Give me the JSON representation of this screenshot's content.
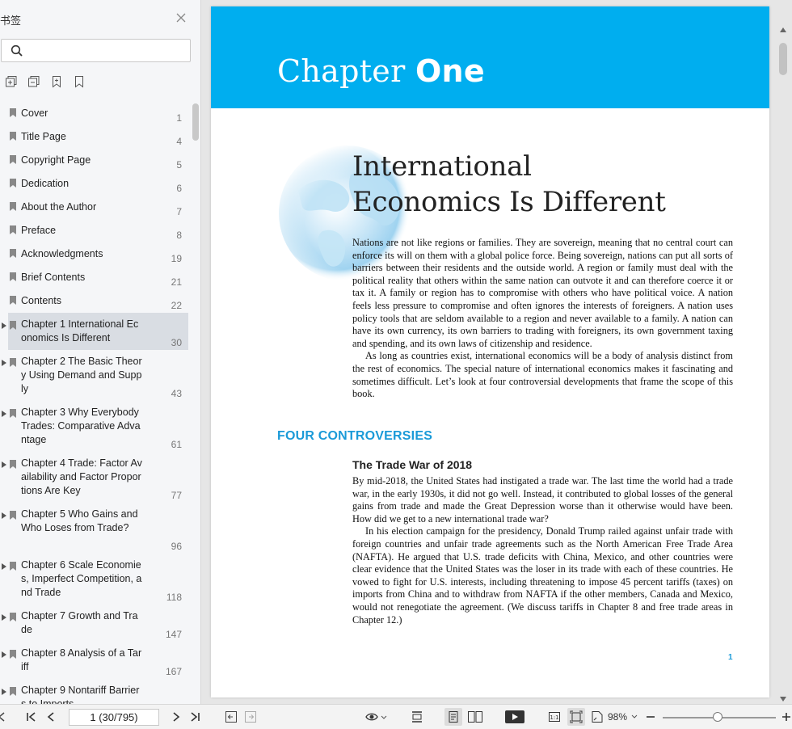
{
  "sidebar": {
    "title": "书签",
    "search_placeholder": "",
    "items": [
      {
        "label": "Cover",
        "page": "1"
      },
      {
        "label": "Title Page",
        "page": "4"
      },
      {
        "label": "Copyright Page",
        "page": "5"
      },
      {
        "label": "Dedication",
        "page": "6"
      },
      {
        "label": "About the Author",
        "page": "7"
      },
      {
        "label": "Preface",
        "page": "8"
      },
      {
        "label": "Acknowledgments",
        "page": "19"
      },
      {
        "label": "Brief Contents",
        "page": "21"
      },
      {
        "label": "Contents",
        "page": "22"
      },
      {
        "label": "Chapter 1 International Economics Is Different",
        "page": "30"
      },
      {
        "label": "Chapter 2 The Basic Theory Using Demand and Supply",
        "page": "43"
      },
      {
        "label": "Chapter 3 Why Everybody Trades: Comparative Advantage",
        "page": "61"
      },
      {
        "label": "Chapter 4 Trade: Factor Availability and Factor Proportions Are Key",
        "page": "77"
      },
      {
        "label": "Chapter 5 Who Gains and Who Loses from Trade?",
        "page": "96"
      },
      {
        "label": "Chapter 6 Scale Economies, Imperfect Competition, and Trade",
        "page": "118"
      },
      {
        "label": "Chapter 7 Growth and Trade",
        "page": "147"
      },
      {
        "label": "Chapter 8 Analysis of a Tariff",
        "page": "167"
      },
      {
        "label": "Chapter 9 Nontariff Barriers to Imports",
        "page": ""
      }
    ]
  },
  "document": {
    "chapter_word": "Chapter",
    "chapter_number": "One",
    "title_line1": "International",
    "title_line2": "Economics Is Different",
    "intro_p1": "Nations are not like regions or families. They are sovereign, meaning that no central court can enforce its will on them with a global police force. Being sovereign, nations can put all sorts of barriers between their residents and the outside world. A region or family must deal with the political reality that others within the same nation can outvote it and can therefore coerce it or tax it. A family or region has to compromise with others who have political voice. A nation feels less pressure to compromise and often ignores the interests of foreigners. A nation uses policy tools that are seldom available to a region and never available to a family. A nation can have its own currency, its own barriers to trading with foreigners, its own government taxing and spending, and its own laws of citizenship and residence.",
    "intro_p2": "As long as countries exist, international economics will be a body of analysis distinct from the rest of economics. The special nature of international economics makes it fascinating and sometimes difficult. Let’s look at four controversial developments that frame the scope of this book.",
    "section_heading": "FOUR CONTROVERSIES",
    "sub_heading": "The Trade War of 2018",
    "war_p1": "By mid-2018, the United States had instigated a trade war. The last time the world had a trade war, in the early 1930s, it did not go well. Instead, it contributed to global losses of the general gains from trade and made the Great Depression worse than it otherwise would have been. How did we get to a new international trade war?",
    "war_p2": "In his election campaign for the presidency, Donald Trump railed against unfair trade with foreign countries and unfair trade agreements such as the North American Free Trade Area (NAFTA). He argued that U.S. trade deficits with China, Mexico, and other countries were clear evidence that the United States was the loser in its trade with each of these countries. He vowed to fight for U.S. interests, including threatening to impose 45 percent tariffs (taxes) on imports from China and to withdraw from NAFTA if the other members, Canada and Mexico, would not renegotiate the agreement. (We discuss tariffs in Chapter 8 and free trade areas in Chapter 12.)",
    "page_number": "1"
  },
  "bottombar": {
    "page_indicator": "1 (30/795)",
    "zoom": "98%"
  },
  "colors": {
    "banner": "#00aeef",
    "accent": "#1a9ad8"
  }
}
